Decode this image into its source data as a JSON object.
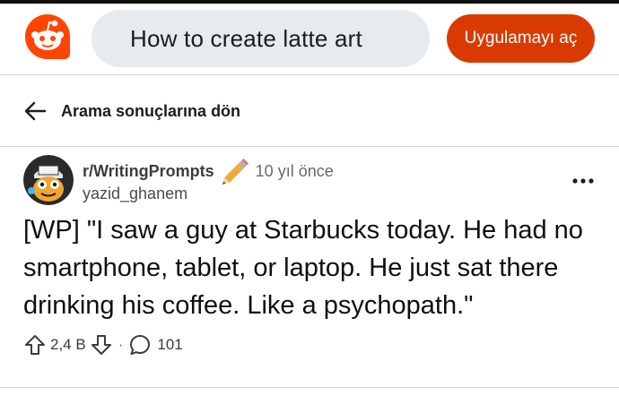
{
  "header": {
    "search_value": "How to create latte art",
    "open_app_label": "Uygulamayı aç",
    "brand_color": "#d93a00"
  },
  "nav": {
    "back_label": "Arama sonuçlarına dön",
    "back_icon": "arrow-left-icon"
  },
  "post": {
    "subreddit": "r/WritingPrompts",
    "time_ago": "10 yıl önce",
    "author": "yazid_ghanem",
    "title": "[WP] \"I saw a guy at Starbucks today. He had no smartphone, tablet, or laptop. He just sat there drinking his coffee. Like a psychopath.\"",
    "score": "2,4 B",
    "separator": "·",
    "comment_count": "101",
    "icons": [
      "upvote-icon",
      "downvote-icon",
      "comment-icon",
      "more-options-icon",
      "pencil-icon"
    ]
  }
}
